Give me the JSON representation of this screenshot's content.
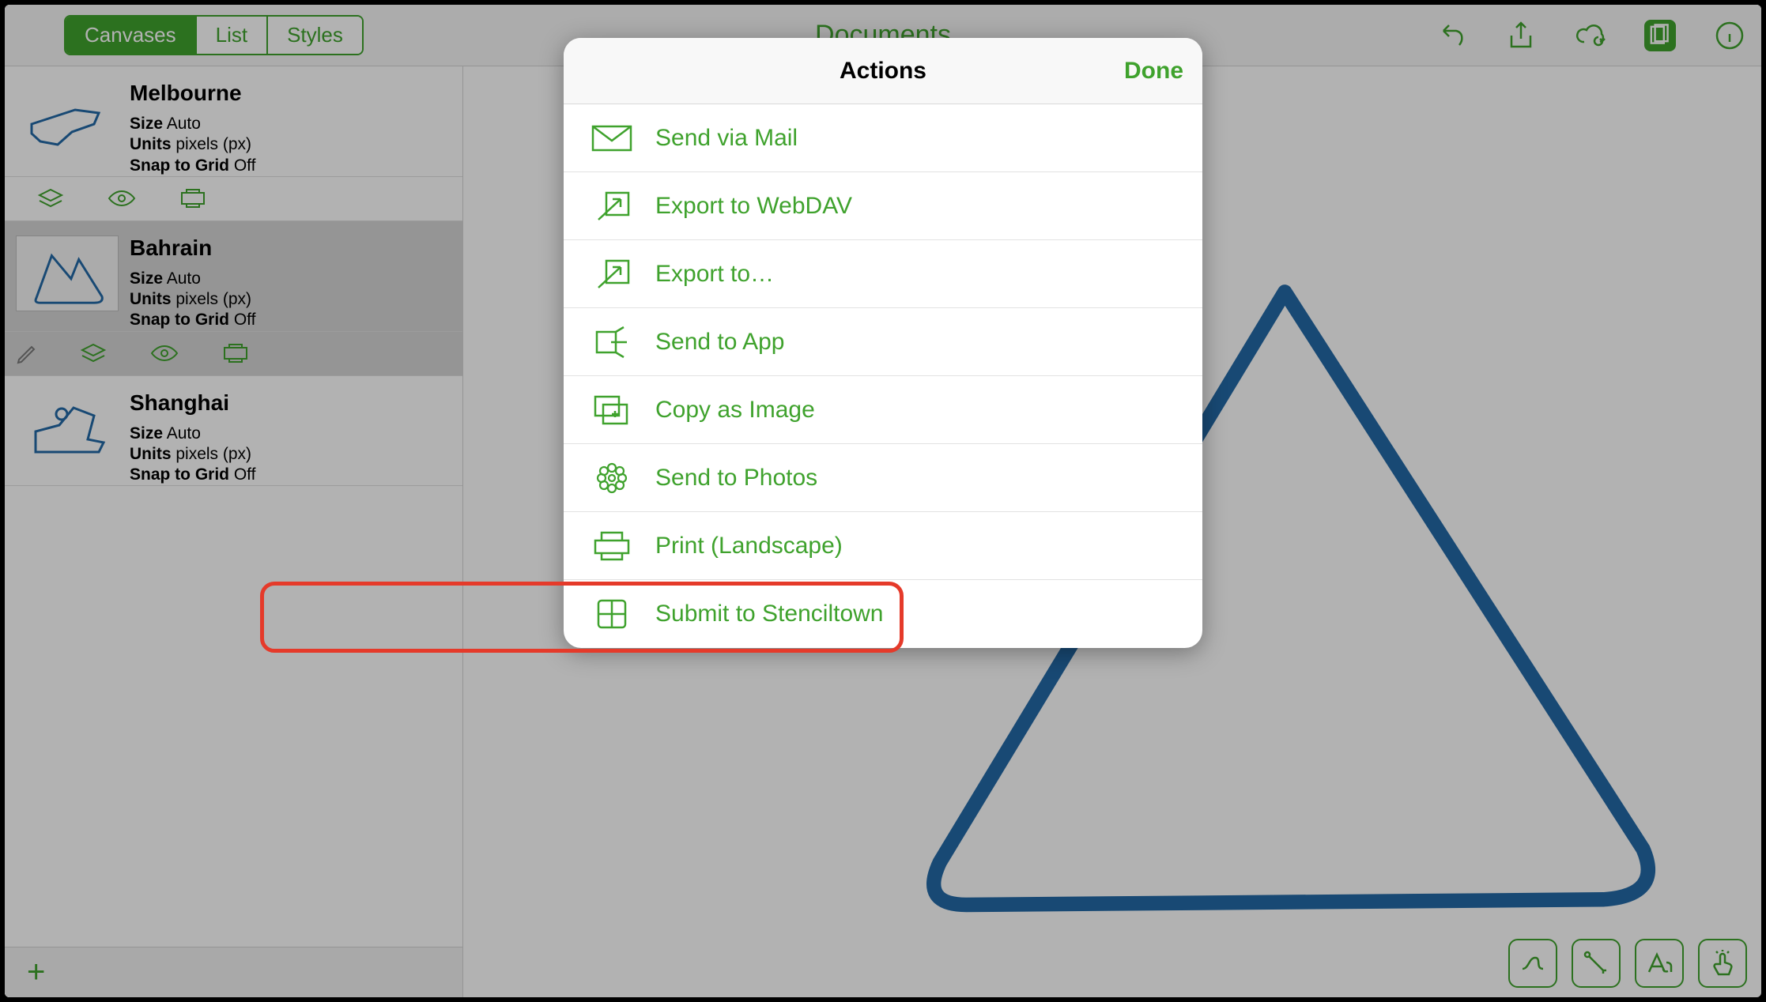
{
  "toolbar": {
    "segments": [
      "Canvases",
      "List",
      "Styles"
    ],
    "active_segment": 0,
    "center_title": "Documents"
  },
  "sidebar": {
    "canvases": [
      {
        "name": "Melbourne",
        "size_label": "Size",
        "size_value": "Auto",
        "units_label": "Units",
        "units_value": "pixels (px)",
        "snap_label": "Snap to Grid",
        "snap_value": "Off",
        "selected": false
      },
      {
        "name": "Bahrain",
        "size_label": "Size",
        "size_value": "Auto",
        "units_label": "Units",
        "units_value": "pixels (px)",
        "snap_label": "Snap to Grid",
        "snap_value": "Off",
        "selected": true
      },
      {
        "name": "Shanghai",
        "size_label": "Size",
        "size_value": "Auto",
        "units_label": "Units",
        "units_value": "pixels (px)",
        "snap_label": "Snap to Grid",
        "snap_value": "Off",
        "selected": false
      }
    ],
    "add_label": "+"
  },
  "popover": {
    "title": "Actions",
    "done_label": "Done",
    "actions": [
      {
        "icon": "mail",
        "label": "Send via Mail"
      },
      {
        "icon": "webdav",
        "label": "Export to WebDAV"
      },
      {
        "icon": "export",
        "label": "Export to…"
      },
      {
        "icon": "sendapp",
        "label": "Send to App"
      },
      {
        "icon": "copyimg",
        "label": "Copy as Image"
      },
      {
        "icon": "photos",
        "label": "Send to Photos"
      },
      {
        "icon": "print",
        "label": "Print (Landscape)"
      },
      {
        "icon": "stencil",
        "label": "Submit to Stenciltown"
      }
    ],
    "highlighted_index": 7
  },
  "colors": {
    "accent": "#3fa22d",
    "highlight_border": "#e53a2a",
    "track_stroke": "#2369a6"
  }
}
